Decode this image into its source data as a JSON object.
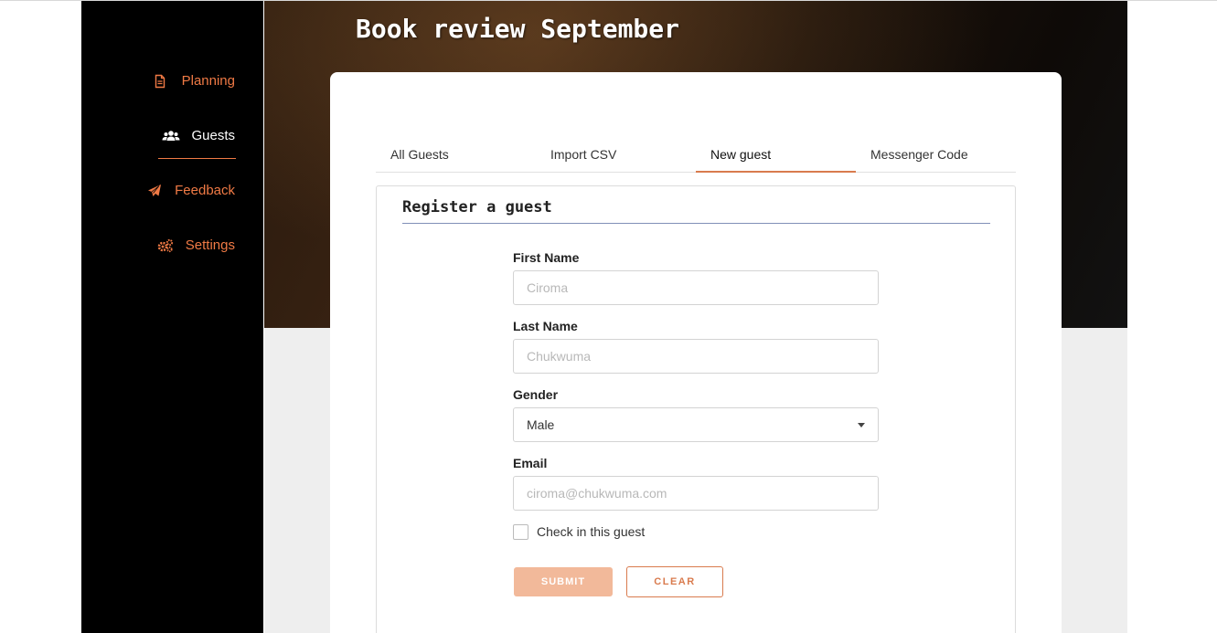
{
  "page": {
    "title": "Book review September"
  },
  "sidebar": {
    "items": [
      {
        "label": "Planning",
        "icon": "file-icon"
      },
      {
        "label": "Guests",
        "icon": "users-icon"
      },
      {
        "label": "Feedback",
        "icon": "paper-plane-icon"
      },
      {
        "label": "Settings",
        "icon": "gears-icon"
      }
    ],
    "active": "Guests",
    "accent_color": "#f07a45"
  },
  "tabs": [
    {
      "label": "All Guests"
    },
    {
      "label": "Import CSV"
    },
    {
      "label": "New guest"
    },
    {
      "label": "Messenger Code"
    }
  ],
  "active_tab": "New guest",
  "form": {
    "title": "Register a guest",
    "first_name": {
      "label": "First Name",
      "placeholder": "Ciroma"
    },
    "last_name": {
      "label": "Last Name",
      "placeholder": "Chukwuma"
    },
    "gender": {
      "label": "Gender",
      "value": "Male"
    },
    "email": {
      "label": "Email",
      "placeholder": "ciroma@chukwuma.com"
    },
    "checkin": {
      "label": "Check in this guest",
      "checked": false
    },
    "submit_label": "SUBMIT",
    "clear_label": "CLEAR"
  }
}
